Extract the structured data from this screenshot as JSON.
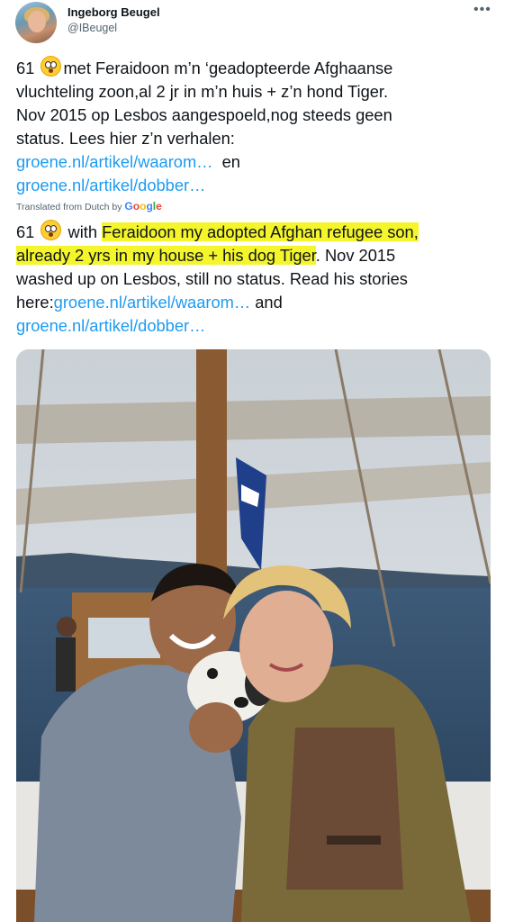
{
  "user": {
    "display_name": "Ingeborg Beugel",
    "handle": "@IBeugel"
  },
  "original": {
    "line1_pre": "61",
    "line1_post": "met Feraidoon m’n ‘geadopteerde Afghaanse",
    "line2": "vluchteling zoon,al 2 jr in m’n huis + z’n hond Tiger.",
    "line3": "Nov 2015 op Lesbos aangespoeld,nog steeds geen",
    "line4": "status. Lees hier z’n verhalen:",
    "link1": "groene.nl/artikel/waarom…",
    "connector": "en",
    "link2": "groene.nl/artikel/dobber…"
  },
  "translation_label": {
    "prefix": "Translated from Dutch by",
    "provider": "Google"
  },
  "translation": {
    "pre": "61",
    "with": "with",
    "highlight1": "Feraidoon my adopted Afghan refugee son,",
    "highlight2": "already 2 yrs in my house + his dog Tiger",
    "line2_rest": ". Nov 2015",
    "line3": "washed up on Lesbos, still no status. Read his stories",
    "line4_pre": "here:",
    "link1": "groene.nl/artikel/waarom…",
    "connector": "and",
    "link2": "groene.nl/artikel/dobber…"
  },
  "icons": {
    "more": "more-icon",
    "emoji": "flushed-face-emoji"
  },
  "colors": {
    "link": "#1d9bf0",
    "highlight": "#f4f52a",
    "secondary_text": "#536471"
  }
}
